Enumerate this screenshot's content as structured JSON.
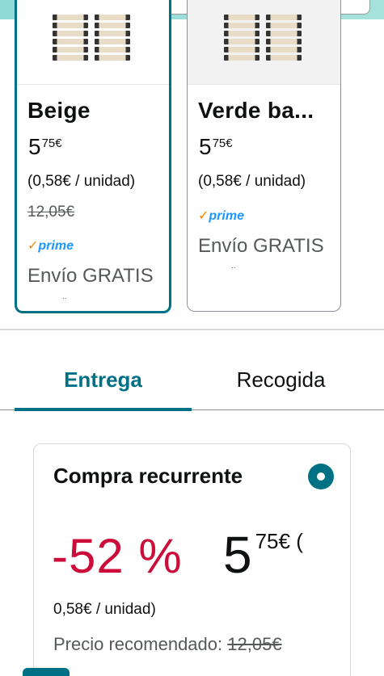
{
  "variants": [
    {
      "name": "Beige",
      "price_whole": "5",
      "price_fraction": "75€",
      "unit_price": "(0,58€ / unidad)",
      "list_price": "12,05€",
      "prime_label": "prime",
      "prime_check": "✓",
      "shipping": "Envío GRATIS",
      "truncated": "..",
      "selected": true
    },
    {
      "name": "Verde ba...",
      "price_whole": "5",
      "price_fraction": "75€",
      "unit_price": "(0,58€ / unidad)",
      "prime_label": "prime",
      "prime_check": "✓",
      "shipping": "Envío GRATIS",
      "truncated": "..",
      "selected": false
    }
  ],
  "tabs": {
    "delivery": "Entrega",
    "pickup": "Recogida",
    "active": "delivery"
  },
  "subscribe": {
    "title": "Compra recurrente",
    "discount": "-52 %",
    "price_whole": "5",
    "price_fraction": "75€ (",
    "unit_price": "0,58€ / unidad)",
    "recommended_label": "Precio recomendado:",
    "recommended_price": "12,05€",
    "selected": true
  },
  "colors": {
    "accent": "#007185",
    "discount": "#cc0c39",
    "prime_blue": "#1a98ff",
    "prime_check": "#f08804",
    "header_teal": "#8fd9d6"
  }
}
